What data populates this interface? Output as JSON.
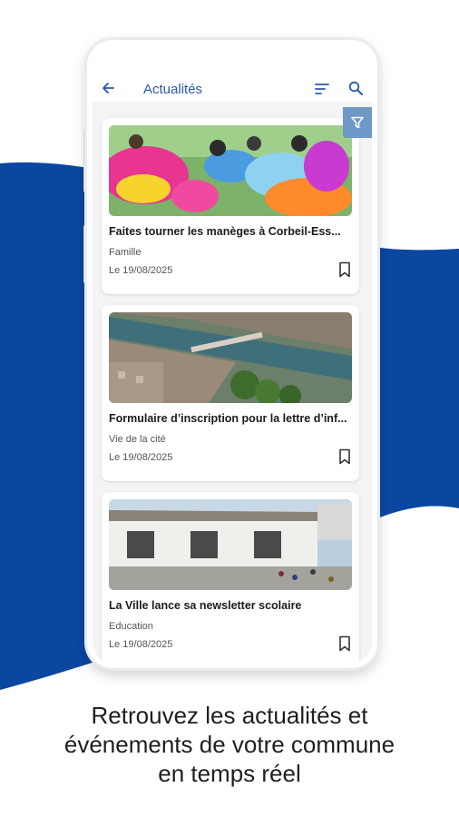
{
  "app": {
    "title": "Actualités"
  },
  "articles": [
    {
      "title": "Faites tourner les manèges à Corbeil-Ess...",
      "category": "Famille",
      "date": "Le 19/08/2025",
      "image_icon": "carnival-ride-photo"
    },
    {
      "title": "Formulaire d’inscription pour la lettre d’inf...",
      "category": "Vie de la cité",
      "date": "Le 19/08/2025",
      "image_icon": "river-city-aerial-photo"
    },
    {
      "title": "La Ville lance sa newsletter scolaire",
      "category": "Education",
      "date": "Le 19/08/2025",
      "image_icon": "school-building-photo"
    }
  ],
  "caption": {
    "line1": "Retrouvez les actualités et",
    "line2": "événements de votre commune",
    "line3": "en temps réel"
  },
  "colors": {
    "brand_blue": "#0a47a0",
    "title_blue": "#2b5aa6",
    "filter_blue": "#6f98c9"
  }
}
